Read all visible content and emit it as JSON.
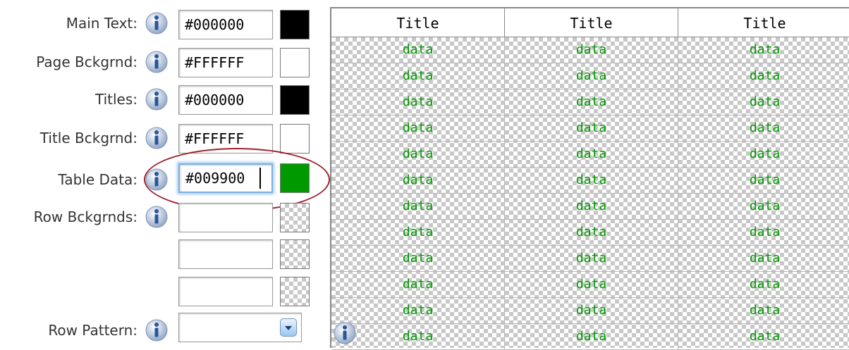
{
  "settings": {
    "main_text": {
      "label": "Main Text:",
      "value": "#000000",
      "color": "#000000"
    },
    "page_background": {
      "label": "Page Bckgrnd:",
      "value": "#FFFFFF",
      "color": "#FFFFFF"
    },
    "titles": {
      "label": "Titles:",
      "value": "#000000",
      "color": "#000000"
    },
    "title_background": {
      "label": "Title Bckgrnd:",
      "value": "#FFFFFF",
      "color": "#FFFFFF"
    },
    "table_data": {
      "label": "Table Data:",
      "value": "#009900",
      "color": "#009900"
    },
    "row_backgrounds": {
      "label": "Row Bckgrnds:",
      "values": [
        "",
        "",
        ""
      ]
    },
    "row_pattern": {
      "label": "Row Pattern:",
      "value": ""
    }
  },
  "info_icon": "info-icon",
  "preview": {
    "headers": [
      "Title",
      "Title",
      "Title"
    ],
    "cell_text": "data",
    "row_count": 12,
    "data_color": "#009900"
  }
}
